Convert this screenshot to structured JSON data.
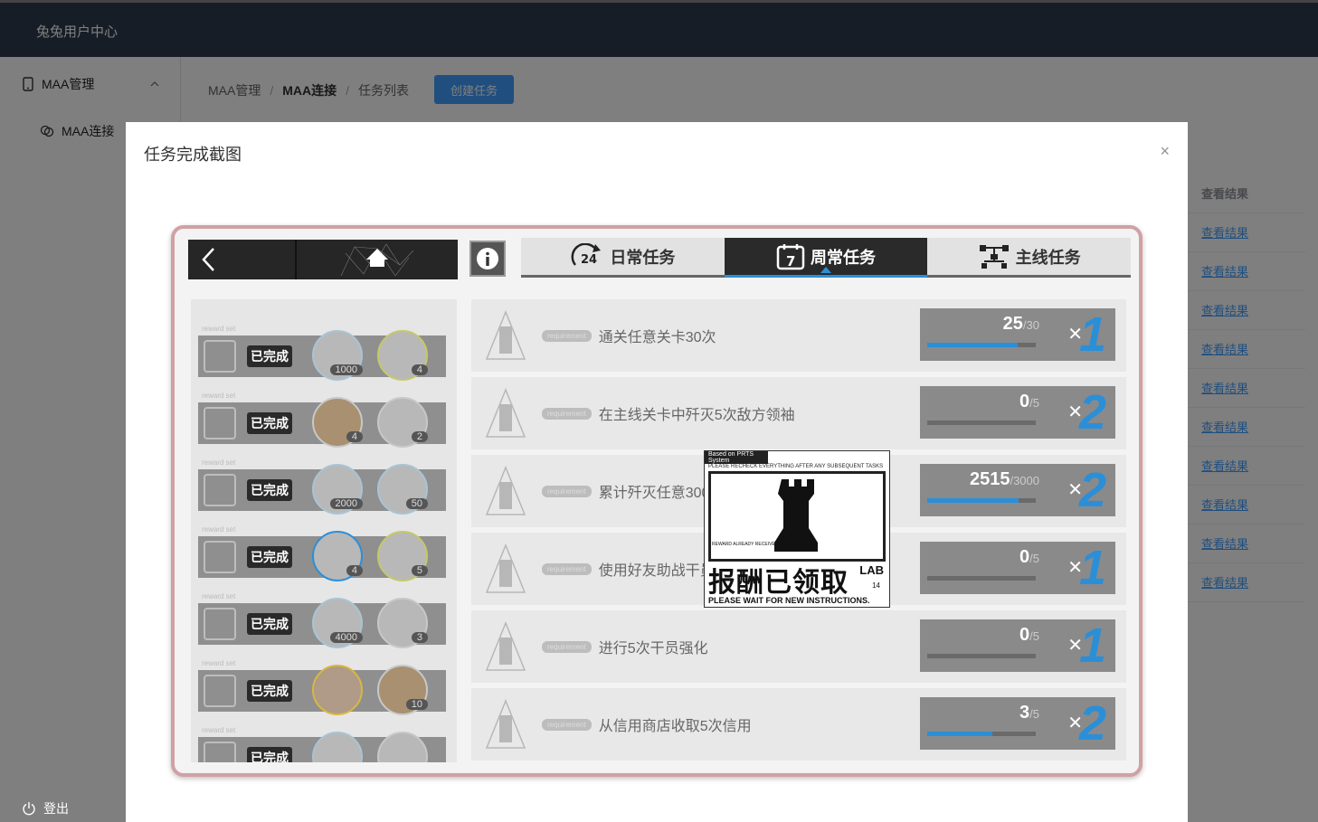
{
  "app": {
    "brand": "兔兔用户中心"
  },
  "sidebar": {
    "menu_label": "MAA管理",
    "sub_label": "MAA连接",
    "logout_label": "登出"
  },
  "breadcrumb": {
    "item1": "MAA管理",
    "item2": "MAA连接",
    "item3": "任务列表",
    "separator": "/"
  },
  "toolbar": {
    "create_label": "创建任务"
  },
  "table": {
    "result_header": "查看结果",
    "result_links": [
      "查看结果",
      "查看结果",
      "查看结果",
      "查看结果",
      "查看结果",
      "查看结果",
      "查看结果",
      "查看结果",
      "查看结果",
      "查看结果"
    ]
  },
  "dialog": {
    "title": "任务完成截图",
    "close": "×"
  },
  "game": {
    "tabs": [
      {
        "label": "日常任务",
        "icon": "24h-refresh-icon"
      },
      {
        "label": "周常任务",
        "icon": "calendar-7-icon",
        "active": true
      },
      {
        "label": "主线任务",
        "icon": "tree-icon"
      }
    ],
    "rewards": [
      {
        "status": "已完成",
        "items": [
          {
            "qty": "1000"
          },
          {
            "qty": "4"
          }
        ]
      },
      {
        "status": "已完成",
        "items": [
          {
            "qty": "4"
          },
          {
            "qty": "2"
          }
        ]
      },
      {
        "status": "已完成",
        "items": [
          {
            "qty": "2000"
          },
          {
            "qty": "50"
          }
        ]
      },
      {
        "status": "已完成",
        "items": [
          {
            "qty": "4"
          },
          {
            "qty": "5"
          }
        ]
      },
      {
        "status": "已完成",
        "items": [
          {
            "qty": "4000"
          },
          {
            "qty": "3"
          }
        ]
      },
      {
        "status": "已完成",
        "items": [
          {
            "qty": ""
          },
          {
            "qty": "10"
          }
        ]
      },
      {
        "status": "已完成",
        "items": [
          {
            "qty": ""
          },
          {
            "qty": ""
          }
        ]
      }
    ],
    "tasks": [
      {
        "req": "requirement",
        "name": "通关任意关卡30次",
        "current": "25",
        "total": "/30",
        "mult": "1",
        "progress": 0.83
      },
      {
        "req": "requirement",
        "name": "在主线关卡中歼灭5次敌方领袖",
        "current": "0",
        "total": "/5",
        "mult": "2",
        "progress": 0
      },
      {
        "req": "requirement",
        "name": "累计歼灭任意3000名敌兵",
        "current": "2515",
        "total": "/3000",
        "mult": "2",
        "progress": 0.84
      },
      {
        "req": "requirement",
        "name": "使用好友助战干员通关",
        "current": "0",
        "total": "/5",
        "mult": "1",
        "progress": 0
      },
      {
        "req": "requirement",
        "name": "进行5次干员强化",
        "current": "0",
        "total": "/5",
        "mult": "1",
        "progress": 0
      },
      {
        "req": "requirement",
        "name": "从信用商店收取5次信用",
        "current": "3",
        "total": "/5",
        "mult": "2",
        "progress": 0.6
      }
    ],
    "stamp": {
      "line1": "Based on PRTS System",
      "line2": "PLEASE RECHECK EVERYTHING AFTER ANY SUBSEQUENT TASKS",
      "small": "REWARD ALREADY RECEIVED",
      "big": "报酬已领取",
      "lab": "LAB",
      "num": "14",
      "line3": "PLEASE WAIT FOR NEW INSTRUCTIONS."
    }
  },
  "colors": {
    "accent": "#409eff",
    "game_blue": "#2b8fd8",
    "frame": "#d1a0a5"
  }
}
